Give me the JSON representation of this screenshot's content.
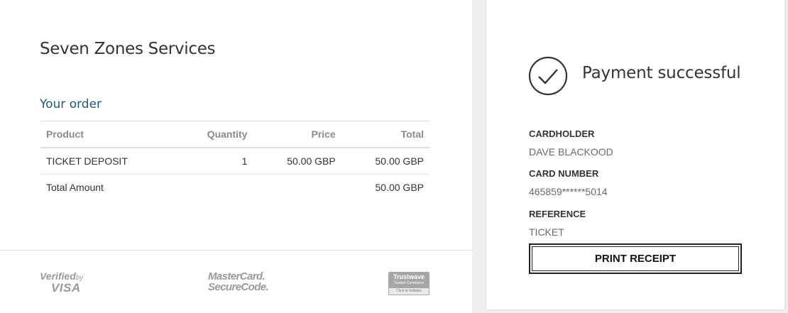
{
  "merchant": {
    "name": "Seven Zones Services"
  },
  "order": {
    "title": "Your order",
    "columns": {
      "product": "Product",
      "quantity": "Quantity",
      "price": "Price",
      "total": "Total"
    },
    "items": [
      {
        "product": "TICKET DEPOSIT",
        "quantity": "1",
        "price": "50.00 GBP",
        "total": "50.00 GBP"
      }
    ],
    "total_label": "Total Amount",
    "total_value": "50.00 GBP"
  },
  "logos": {
    "visa": {
      "line1": "Verified",
      "by": "by",
      "line2": "VISA"
    },
    "mastercard": {
      "line1": "MasterCard.",
      "line2": "SecureCode."
    },
    "trustwave": {
      "line1": "Trustwave",
      "line2": "Trusted Commerce",
      "line3": "Click to Validate"
    }
  },
  "payment": {
    "status": "Payment successful",
    "cardholder_label": "CARDHOLDER",
    "cardholder_value": "DAVE BLACKOOD",
    "card_number_label": "CARD NUMBER",
    "card_number_value": "465859******5014",
    "reference_label": "REFERENCE",
    "reference_value": "TICKET",
    "print_button": "PRINT RECEIPT",
    "check_icon": "check-circle-icon"
  },
  "colors": {
    "accent": "#1a5a78",
    "text": "#333333",
    "muted": "#8a8a8a"
  }
}
